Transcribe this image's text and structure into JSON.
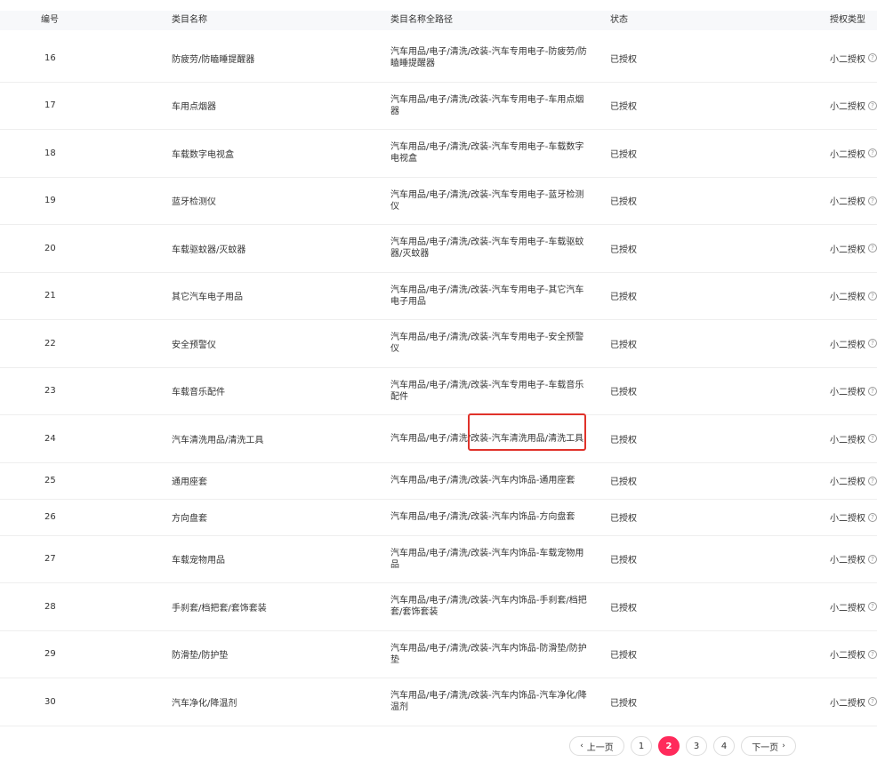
{
  "table": {
    "headers": {
      "id": "编号",
      "name": "类目名称",
      "path": "类目名称全路径",
      "status": "状态",
      "auth_type": "授权类型"
    },
    "rows": [
      {
        "id": "16",
        "name": "防疲劳/防瞌睡提醒器",
        "path": "汽车用品/电子/清洗/改装-汽车专用电子-防疲劳/防瞌睡提醒器",
        "status": "已授权",
        "auth_type": "小二授权"
      },
      {
        "id": "17",
        "name": "车用点烟器",
        "path": "汽车用品/电子/清洗/改装-汽车专用电子-车用点烟器",
        "status": "已授权",
        "auth_type": "小二授权"
      },
      {
        "id": "18",
        "name": "车载数字电视盒",
        "path": "汽车用品/电子/清洗/改装-汽车专用电子-车载数字电视盒",
        "status": "已授权",
        "auth_type": "小二授权"
      },
      {
        "id": "19",
        "name": "蓝牙检测仪",
        "path": "汽车用品/电子/清洗/改装-汽车专用电子-蓝牙检测仪",
        "status": "已授权",
        "auth_type": "小二授权"
      },
      {
        "id": "20",
        "name": "车载驱蚊器/灭蚊器",
        "path": "汽车用品/电子/清洗/改装-汽车专用电子-车载驱蚊器/灭蚊器",
        "status": "已授权",
        "auth_type": "小二授权"
      },
      {
        "id": "21",
        "name": "其它汽车电子用品",
        "path": "汽车用品/电子/清洗/改装-汽车专用电子-其它汽车电子用品",
        "status": "已授权",
        "auth_type": "小二授权"
      },
      {
        "id": "22",
        "name": "安全预警仪",
        "path": "汽车用品/电子/清洗/改装-汽车专用电子-安全预警仪",
        "status": "已授权",
        "auth_type": "小二授权"
      },
      {
        "id": "23",
        "name": "车载音乐配件",
        "path": "汽车用品/电子/清洗/改装-汽车专用电子-车载音乐配件",
        "status": "已授权",
        "auth_type": "小二授权"
      },
      {
        "id": "24",
        "name": "汽车清洗用品/清洗工具",
        "path": "汽车用品/电子/清洗/改装-汽车清洗用品/清洗工具",
        "status": "已授权",
        "auth_type": "小二授权"
      },
      {
        "id": "25",
        "name": "通用座套",
        "path": "汽车用品/电子/清洗/改装-汽车内饰品-通用座套",
        "status": "已授权",
        "auth_type": "小二授权"
      },
      {
        "id": "26",
        "name": "方向盘套",
        "path": "汽车用品/电子/清洗/改装-汽车内饰品-方向盘套",
        "status": "已授权",
        "auth_type": "小二授权"
      },
      {
        "id": "27",
        "name": "车载宠物用品",
        "path": "汽车用品/电子/清洗/改装-汽车内饰品-车载宠物用品",
        "status": "已授权",
        "auth_type": "小二授权"
      },
      {
        "id": "28",
        "name": "手刹套/档把套/套饰套装",
        "path": "汽车用品/电子/清洗/改装-汽车内饰品-手刹套/档把套/套饰套装",
        "status": "已授权",
        "auth_type": "小二授权"
      },
      {
        "id": "29",
        "name": "防滑垫/防护垫",
        "path": "汽车用品/电子/清洗/改装-汽车内饰品-防滑垫/防护垫",
        "status": "已授权",
        "auth_type": "小二授权"
      },
      {
        "id": "30",
        "name": "汽车净化/降温剂",
        "path": "汽车用品/电子/清洗/改装-汽车内饰品-汽车净化/降温剂",
        "status": "已授权",
        "auth_type": "小二授权"
      }
    ]
  },
  "pagination": {
    "prev_label": "上一页",
    "next_label": "下一页",
    "pages": [
      "1",
      "2",
      "3",
      "4"
    ],
    "current": "2"
  },
  "colors": {
    "active_page": "#ff2a5b",
    "highlight_border": "#e0322a",
    "header_bg": "#f7f8fa"
  },
  "icons": {
    "auth_help": "question-circle-icon",
    "prev": "chevron-left-icon",
    "next": "chevron-right-icon"
  }
}
